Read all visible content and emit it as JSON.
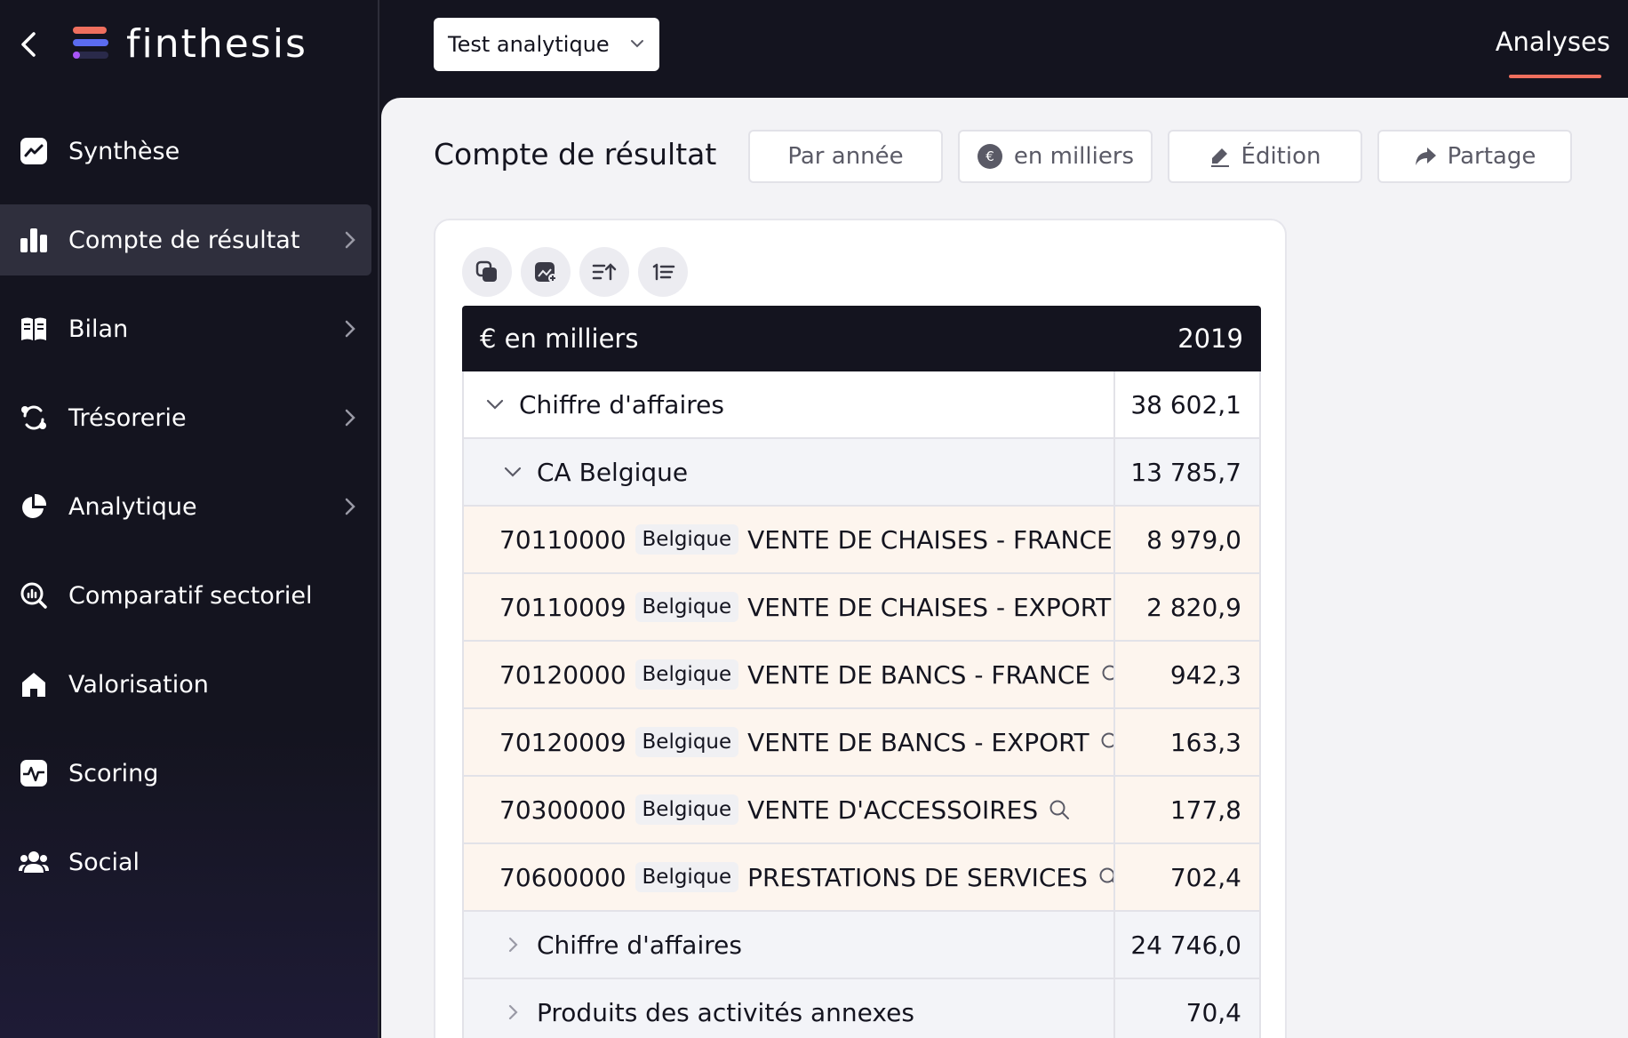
{
  "app": {
    "logo_text": "finthesis"
  },
  "sidebar": {
    "items": [
      {
        "label": "Synthèse",
        "icon": "chart-line-icon",
        "chevron": false
      },
      {
        "label": "Compte de résultat",
        "icon": "bar-chart-icon",
        "chevron": true,
        "active": true
      },
      {
        "label": "Bilan",
        "icon": "book-icon",
        "chevron": true
      },
      {
        "label": "Trésorerie",
        "icon": "cash-cycle-icon",
        "chevron": true
      },
      {
        "label": "Analytique",
        "icon": "pie-chart-icon",
        "chevron": true
      },
      {
        "label": "Comparatif sectoriel",
        "icon": "magnifier-chart-icon",
        "chevron": false
      },
      {
        "label": "Valorisation",
        "icon": "home-icon",
        "chevron": false
      },
      {
        "label": "Scoring",
        "icon": "pulse-icon",
        "chevron": false
      },
      {
        "label": "Social",
        "icon": "users-icon",
        "chevron": false
      }
    ]
  },
  "topbar": {
    "selector_value": "Test analytique",
    "tab_label": "Analyses"
  },
  "main": {
    "title": "Compte de résultat",
    "buttons": {
      "period": "Par année",
      "unit": "en milliers",
      "edit": "Édition",
      "share": "Partage"
    }
  },
  "table": {
    "header_unit": "€ en milliers",
    "header_year": "2019",
    "rows": [
      {
        "label": "Chiffre d'affaires",
        "value": "38 602,1"
      },
      {
        "label": "CA Belgique",
        "value": "13 785,7"
      },
      {
        "code": "70110000",
        "tag": "Belgique",
        "label": "VENTE DE CHAISES - FRANCE",
        "value": "8 979,0"
      },
      {
        "code": "70110009",
        "tag": "Belgique",
        "label": "VENTE DE CHAISES - EXPORT",
        "value": "2 820,9"
      },
      {
        "code": "70120000",
        "tag": "Belgique",
        "label": "VENTE DE BANCS - FRANCE",
        "value": "942,3"
      },
      {
        "code": "70120009",
        "tag": "Belgique",
        "label": "VENTE DE BANCS - EXPORT",
        "value": "163,3"
      },
      {
        "code": "70300000",
        "tag": "Belgique",
        "label": "VENTE D'ACCESSOIRES",
        "value": "177,8"
      },
      {
        "code": "70600000",
        "tag": "Belgique",
        "label": "PRESTATIONS DE SERVICES",
        "value": "702,4"
      },
      {
        "label": "Chiffre d'affaires",
        "value": "24 746,0"
      },
      {
        "label": "Produits des activités annexes",
        "value": "70,4"
      }
    ]
  },
  "colors": {
    "accent": "#ef6f5e",
    "dark": "#14141f",
    "account_row": "#fdf5ee"
  }
}
